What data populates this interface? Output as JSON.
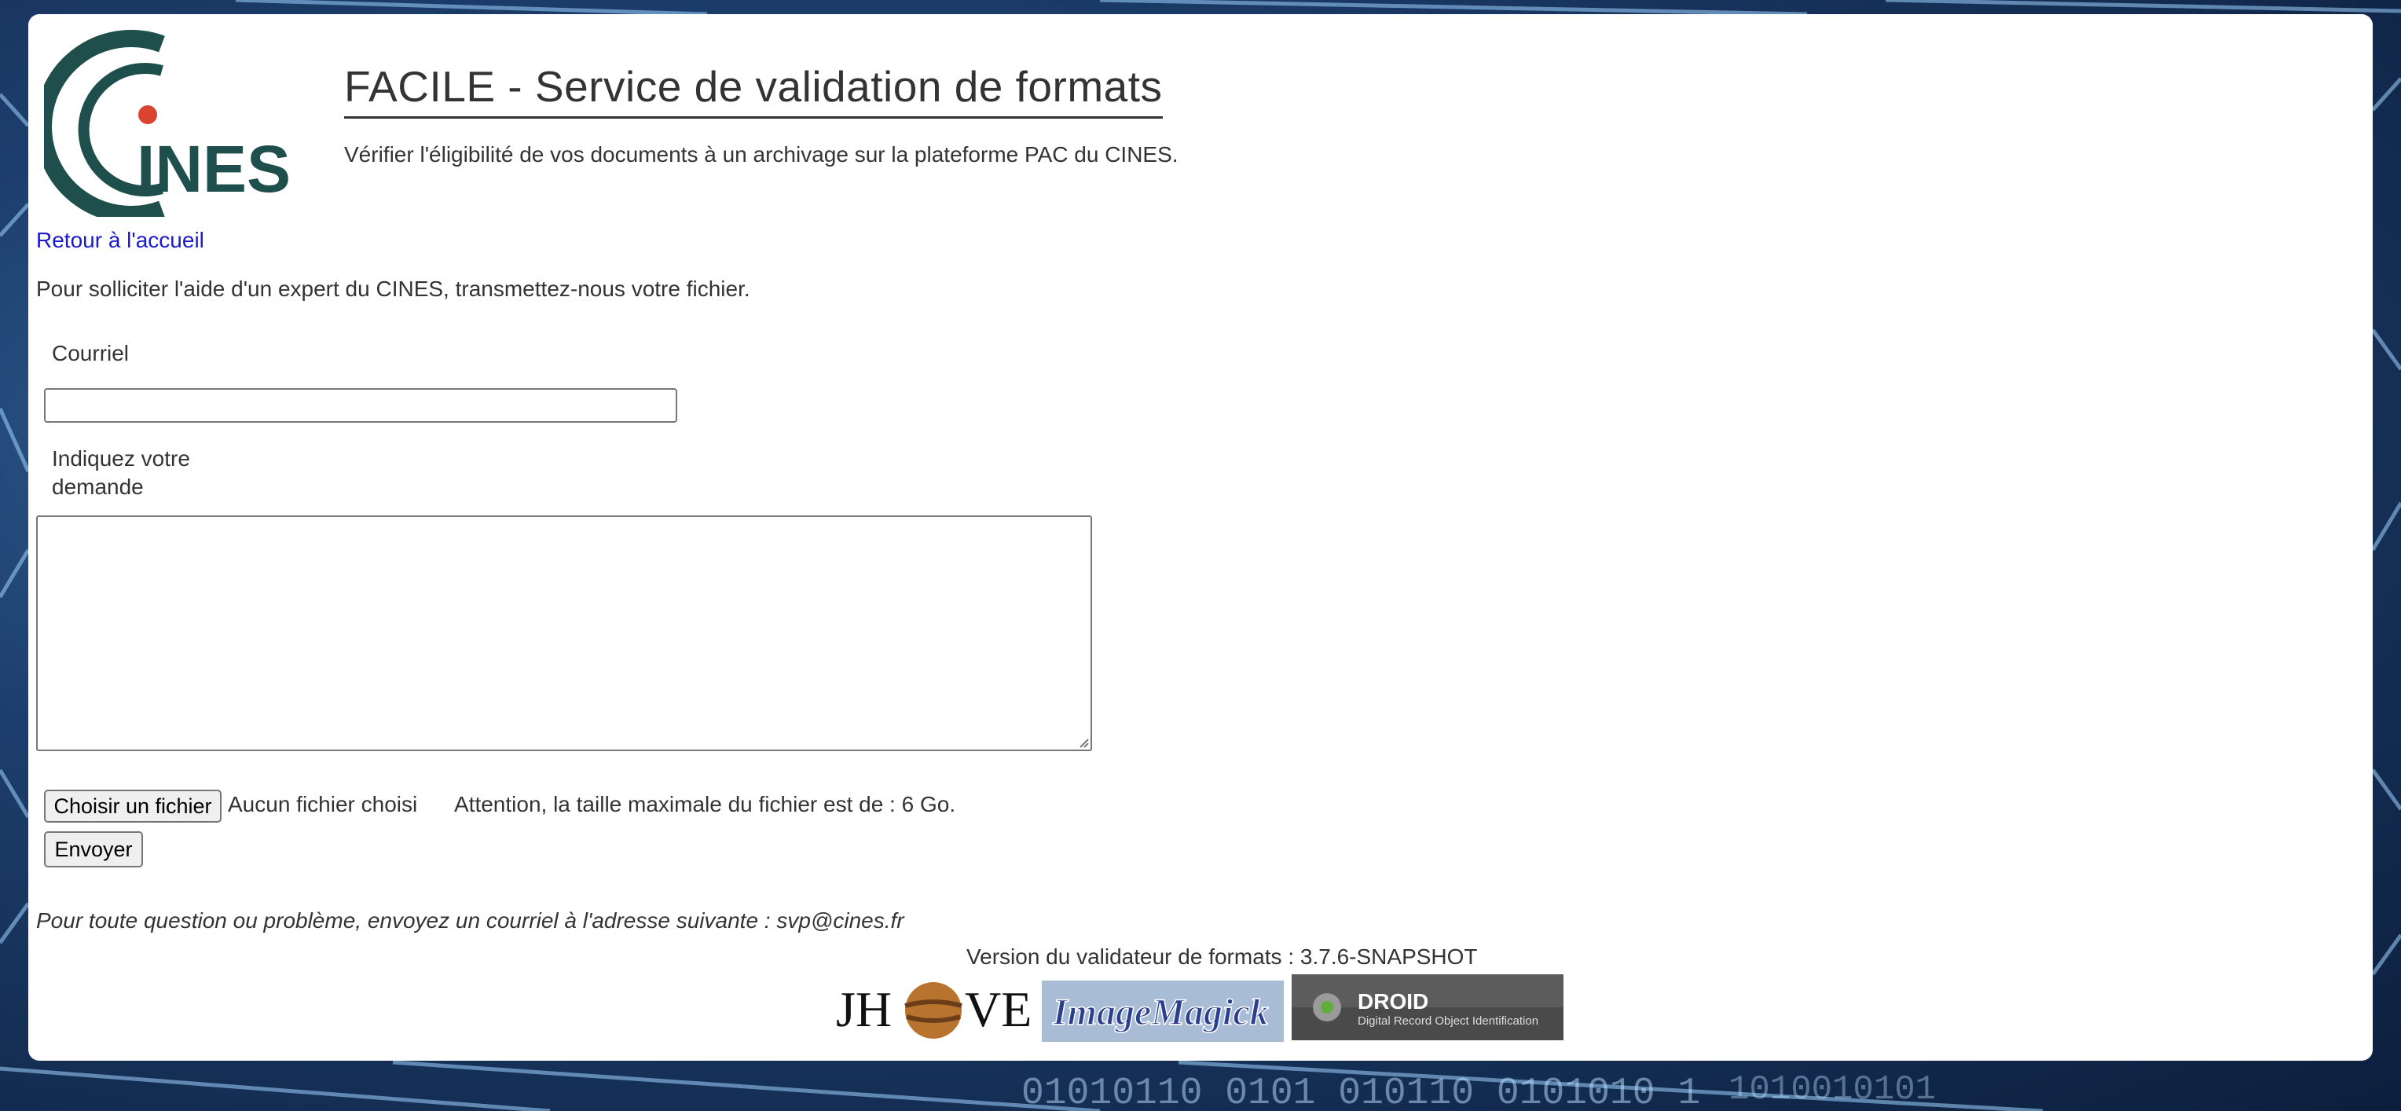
{
  "header": {
    "logo_text": "INES",
    "title": "FACILE - Service de validation de formats",
    "subtitle": "Vérifier l'éligibilité de vos documents à un archivage sur la plateforme PAC du CINES."
  },
  "nav": {
    "home_link": "Retour à l'accueil"
  },
  "form": {
    "intro": "Pour solliciter l'aide d'un expert du CINES, transmettez-nous votre fichier.",
    "email_label": "Courriel",
    "email_value": "",
    "request_label_line1": "Indiquez votre",
    "request_label_line2": "demande",
    "request_value": "",
    "file_button": "Choisir un fichier",
    "file_status": "Aucun fichier choisi",
    "file_warning": "Attention, la taille maximale du fichier est de : 6 Go.",
    "submit_button": "Envoyer"
  },
  "footer": {
    "contact": "Pour toute question ou problème, envoyez un courriel à l'adresse suivante : svp@cines.fr",
    "version": "Version du validateur de formats : 3.7.6-SNAPSHOT",
    "badges": {
      "jhove_prefix": "JH",
      "jhove_suffix": "VE",
      "imagemagick": "ImageMagick",
      "droid_title": "DROID",
      "droid_subtitle": "Digital Record Object Identification"
    }
  },
  "colors": {
    "logo_teal": "#1f4f4c",
    "logo_red": "#d9432f",
    "link": "#1a1acc"
  }
}
